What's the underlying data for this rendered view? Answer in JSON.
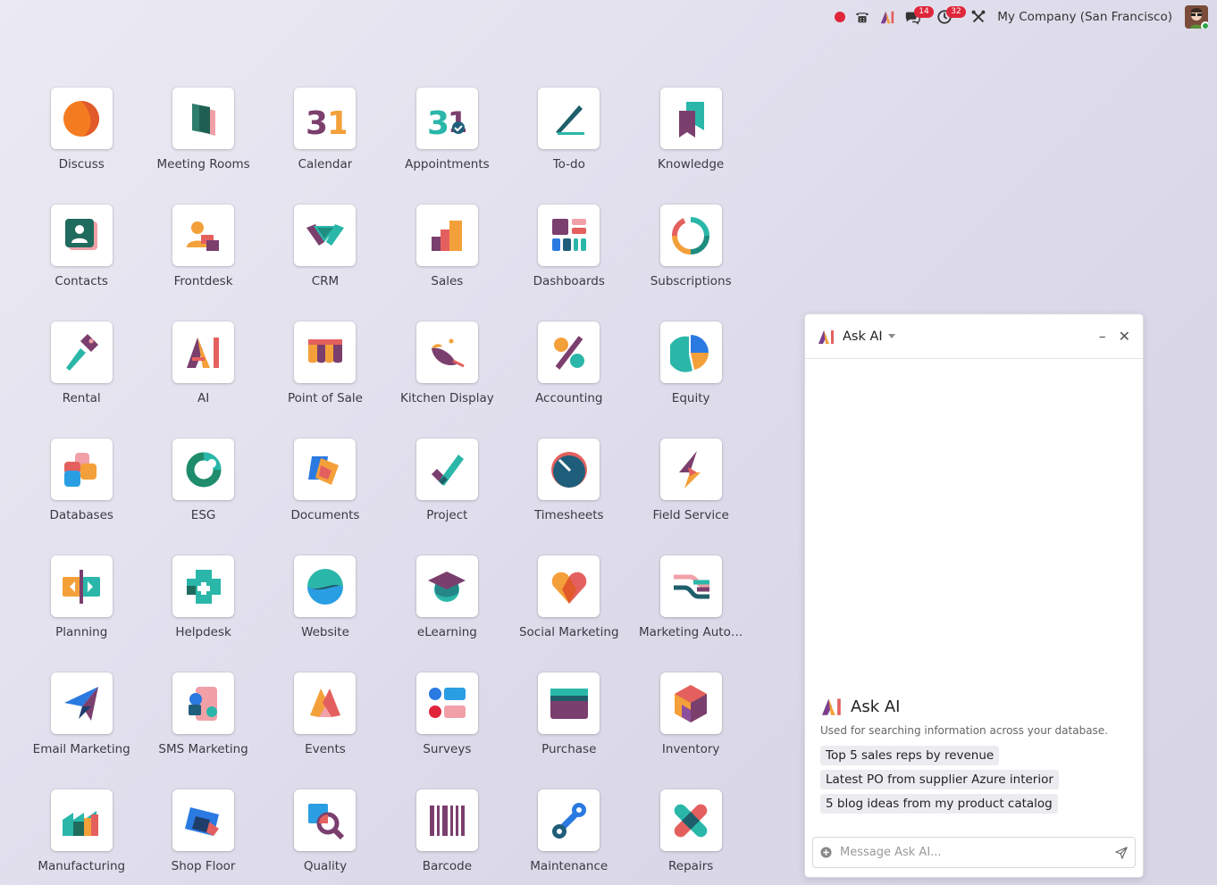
{
  "topbar": {
    "messages_badge": "14",
    "activities_badge": "32",
    "company": "My Company (San Francisco)"
  },
  "apps": [
    {
      "label": "Discuss",
      "icon": "discuss-icon"
    },
    {
      "label": "Meeting Rooms",
      "icon": "meeting-rooms-icon"
    },
    {
      "label": "Calendar",
      "icon": "calendar-icon"
    },
    {
      "label": "Appointments",
      "icon": "appointments-icon"
    },
    {
      "label": "To-do",
      "icon": "todo-icon"
    },
    {
      "label": "Knowledge",
      "icon": "knowledge-icon"
    },
    {
      "label": "Contacts",
      "icon": "contacts-icon"
    },
    {
      "label": "Frontdesk",
      "icon": "frontdesk-icon"
    },
    {
      "label": "CRM",
      "icon": "crm-icon"
    },
    {
      "label": "Sales",
      "icon": "sales-icon"
    },
    {
      "label": "Dashboards",
      "icon": "dashboards-icon"
    },
    {
      "label": "Subscriptions",
      "icon": "subscriptions-icon"
    },
    {
      "label": "Rental",
      "icon": "rental-icon"
    },
    {
      "label": "AI",
      "icon": "ai-icon"
    },
    {
      "label": "Point of Sale",
      "icon": "point-of-sale-icon"
    },
    {
      "label": "Kitchen Display",
      "icon": "kitchen-display-icon"
    },
    {
      "label": "Accounting",
      "icon": "accounting-icon"
    },
    {
      "label": "Equity",
      "icon": "equity-icon"
    },
    {
      "label": "Databases",
      "icon": "databases-icon"
    },
    {
      "label": "ESG",
      "icon": "esg-icon"
    },
    {
      "label": "Documents",
      "icon": "documents-icon"
    },
    {
      "label": "Project",
      "icon": "project-icon"
    },
    {
      "label": "Timesheets",
      "icon": "timesheets-icon"
    },
    {
      "label": "Field Service",
      "icon": "field-service-icon"
    },
    {
      "label": "Planning",
      "icon": "planning-icon"
    },
    {
      "label": "Helpdesk",
      "icon": "helpdesk-icon"
    },
    {
      "label": "Website",
      "icon": "website-icon"
    },
    {
      "label": "eLearning",
      "icon": "elearning-icon"
    },
    {
      "label": "Social Marketing",
      "icon": "social-marketing-icon"
    },
    {
      "label": "Marketing Auto…",
      "icon": "marketing-automation-icon"
    },
    {
      "label": "Email Marketing",
      "icon": "email-marketing-icon"
    },
    {
      "label": "SMS Marketing",
      "icon": "sms-marketing-icon"
    },
    {
      "label": "Events",
      "icon": "events-icon"
    },
    {
      "label": "Surveys",
      "icon": "surveys-icon"
    },
    {
      "label": "Purchase",
      "icon": "purchase-icon"
    },
    {
      "label": "Inventory",
      "icon": "inventory-icon"
    },
    {
      "label": "Manufacturing",
      "icon": "manufacturing-icon"
    },
    {
      "label": "Shop Floor",
      "icon": "shop-floor-icon"
    },
    {
      "label": "Quality",
      "icon": "quality-icon"
    },
    {
      "label": "Barcode",
      "icon": "barcode-icon"
    },
    {
      "label": "Maintenance",
      "icon": "maintenance-icon"
    },
    {
      "label": "Repairs",
      "icon": "repairs-icon"
    }
  ],
  "ask_ai": {
    "title": "Ask AI",
    "intro_title": "Ask AI",
    "intro_desc": "Used for searching information across your database.",
    "suggestions": [
      "Top 5 sales reps by revenue",
      "Latest PO from supplier Azure interior",
      "5 blog ideas from my product catalog"
    ],
    "placeholder": "Message Ask AI..."
  }
}
